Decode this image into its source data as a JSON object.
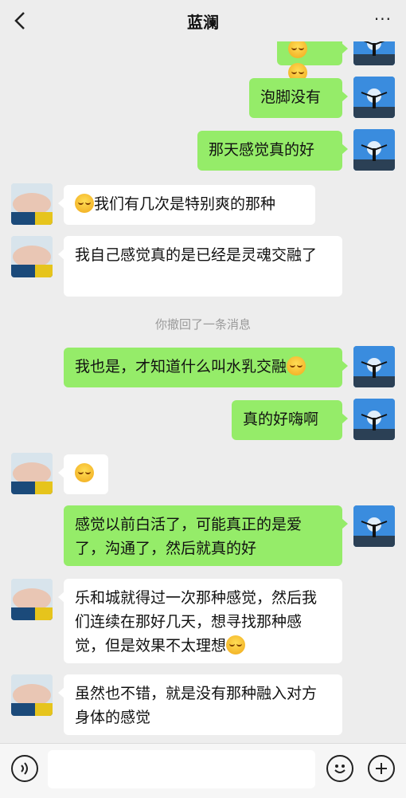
{
  "header": {
    "title": "蓝澜",
    "more_label": "···"
  },
  "system_message": "你撤回了一条消息",
  "messages": [
    {
      "side": "me",
      "text": "泡脚没有"
    },
    {
      "side": "me",
      "text": "那天感觉真的好"
    },
    {
      "side": "her",
      "text": "我们有几次是特别爽的那种",
      "emoji": "smile"
    },
    {
      "side": "her",
      "text": "我自己感觉真的是已经是灵魂交融了"
    },
    {
      "side": "me",
      "text": "我也是，才知道什么叫水乳交融",
      "emoji": "smile"
    },
    {
      "side": "me",
      "text": "真的好嗨啊"
    },
    {
      "side": "her",
      "text": "",
      "emoji": "smile"
    },
    {
      "side": "me",
      "text": "感觉以前白活了，可能真正的是爱了，沟通了，然后就真的好"
    },
    {
      "side": "her",
      "text": "乐和城就得过一次那种感觉，然后我们连续在那好几天，想寻找那种感觉，但是效果不太理想",
      "emoji": "thinking"
    },
    {
      "side": "her",
      "text": "虽然也不错，就是没有那种融入对方身体的感觉"
    }
  ],
  "bottom_bar": {
    "voice_icon": "voice-icon",
    "emoji_icon": "emoji-icon",
    "plus_icon": "plus-icon"
  },
  "colors": {
    "me_bubble": "#95ec69",
    "her_bubble": "#ffffff",
    "background": "#ededed"
  }
}
